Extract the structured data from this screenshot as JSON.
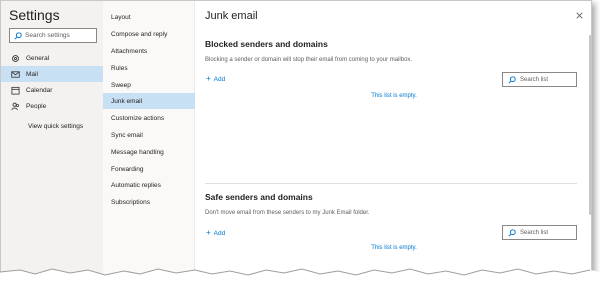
{
  "settings": {
    "title": "Settings",
    "search_placeholder": "Search settings",
    "categories": [
      {
        "label": "General",
        "icon": "gear-icon"
      },
      {
        "label": "Mail",
        "icon": "mail-icon"
      },
      {
        "label": "Calendar",
        "icon": "calendar-icon"
      },
      {
        "label": "People",
        "icon": "people-icon"
      }
    ],
    "view_quick_settings": "View quick settings"
  },
  "mail_menu": {
    "items": [
      "Layout",
      "Compose and reply",
      "Attachments",
      "Rules",
      "Sweep",
      "Junk email",
      "Customize actions",
      "Sync email",
      "Message handling",
      "Forwarding",
      "Automatic replies",
      "Subscriptions"
    ],
    "selected": "Junk email"
  },
  "panel": {
    "title": "Junk email",
    "blocked": {
      "heading": "Blocked senders and domains",
      "description": "Blocking a sender or domain will stop their email from coming to your mailbox.",
      "add_label": "Add",
      "search_placeholder": "Search list",
      "empty_text": "This list is empty."
    },
    "safe": {
      "heading": "Safe senders and domains",
      "description": "Don't move email from these senders to my Junk Email folder.",
      "add_label": "Add",
      "search_placeholder": "Search list",
      "empty_text": "This list is empty."
    }
  },
  "colors": {
    "accent": "#0078d4",
    "selected_bg": "#c7e0f4",
    "left_bg": "#f3f2f1"
  }
}
